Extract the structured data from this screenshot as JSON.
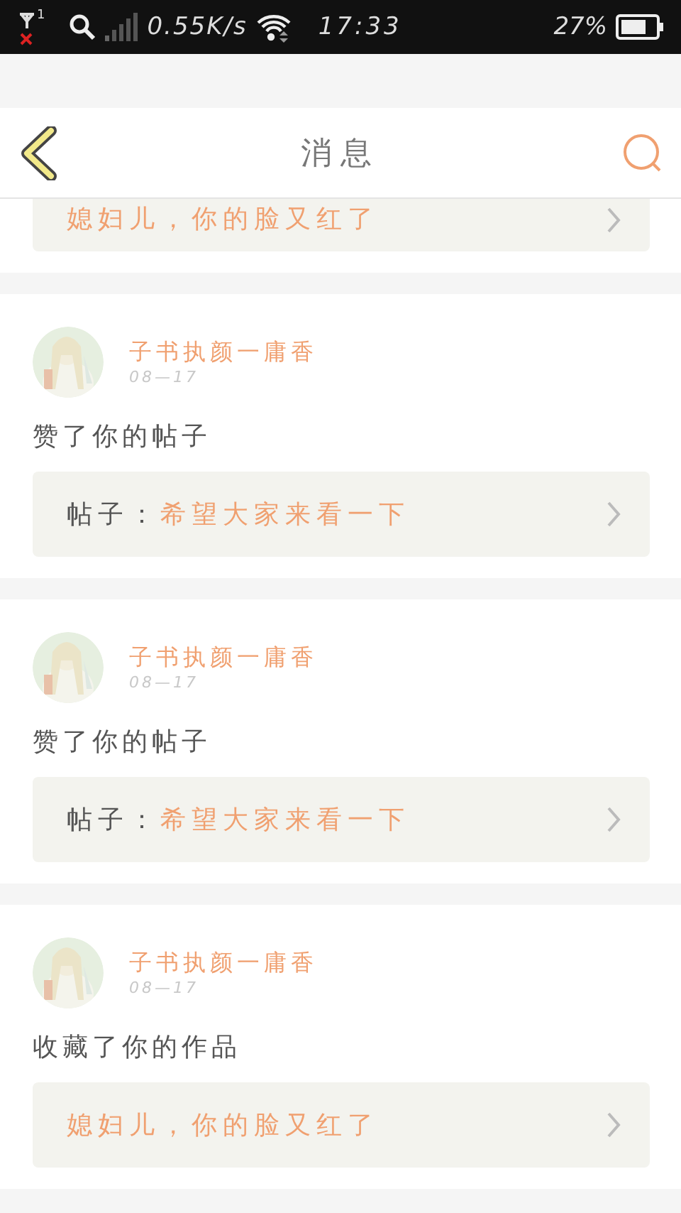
{
  "status_bar": {
    "speed": "0.55K/s",
    "time": "17:33",
    "battery": "27%",
    "sim_label": "1"
  },
  "header": {
    "title": "消息"
  },
  "cards": [
    {
      "partial": true,
      "link": {
        "title": "媳妇儿，你的脸又红了"
      }
    },
    {
      "partial": false,
      "user": "子书执颜一庸香",
      "date": "08—17",
      "action": "赞了你的帖子",
      "link": {
        "prefix": "帖子：",
        "title": "希望大家来看一下"
      }
    },
    {
      "partial": false,
      "user": "子书执颜一庸香",
      "date": "08—17",
      "action": "赞了你的帖子",
      "link": {
        "prefix": "帖子：",
        "title": "希望大家来看一下"
      }
    },
    {
      "partial": false,
      "user": "子书执颜一庸香",
      "date": "08—17",
      "action": "收藏了你的作品",
      "link": {
        "title": "媳妇儿，你的脸又红了"
      }
    }
  ]
}
